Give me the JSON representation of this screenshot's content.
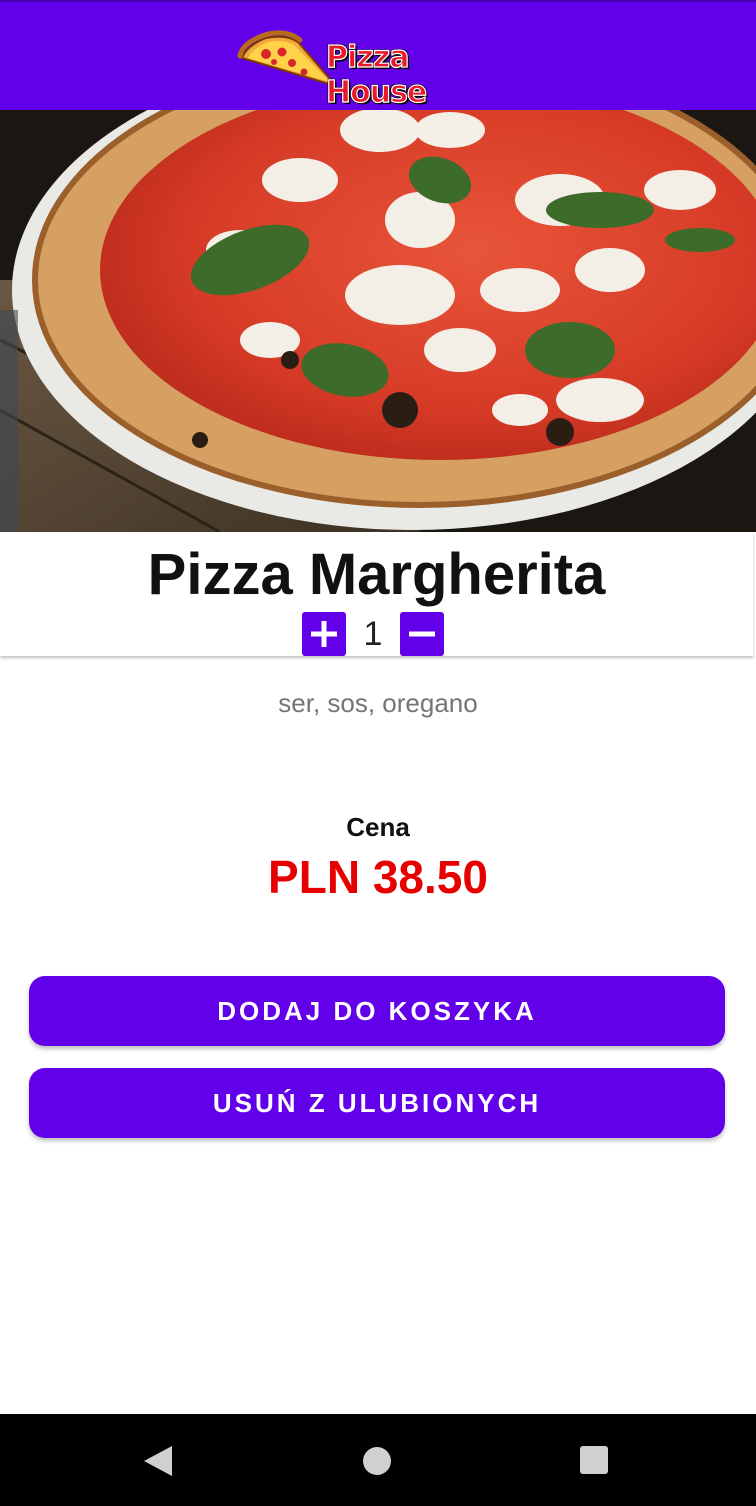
{
  "app_bar": {
    "brand": "Pizza House",
    "background_color": "#6200ea",
    "logo_icon": "pizza-slice-icon"
  },
  "hero_image": {
    "subject": "pizza-margherita-photo"
  },
  "product": {
    "name": "Pizza Margherita",
    "quantity": "1",
    "ingredients": "ser, sos, oregano"
  },
  "stepper": {
    "increment_icon": "plus-icon",
    "decrement_icon": "minus-icon"
  },
  "price": {
    "label": "Cena",
    "value": "PLN 38.50",
    "color": "#e60000"
  },
  "actions": {
    "add_to_cart_label": "DODAJ DO KOSZYKA",
    "remove_favorite_label": "USUŃ Z ULUBIONYCH",
    "accent_color": "#6200ea"
  },
  "nav_bar": {
    "back_icon": "back-triangle-icon",
    "home_icon": "home-circle-icon",
    "recents_icon": "recents-square-icon"
  }
}
